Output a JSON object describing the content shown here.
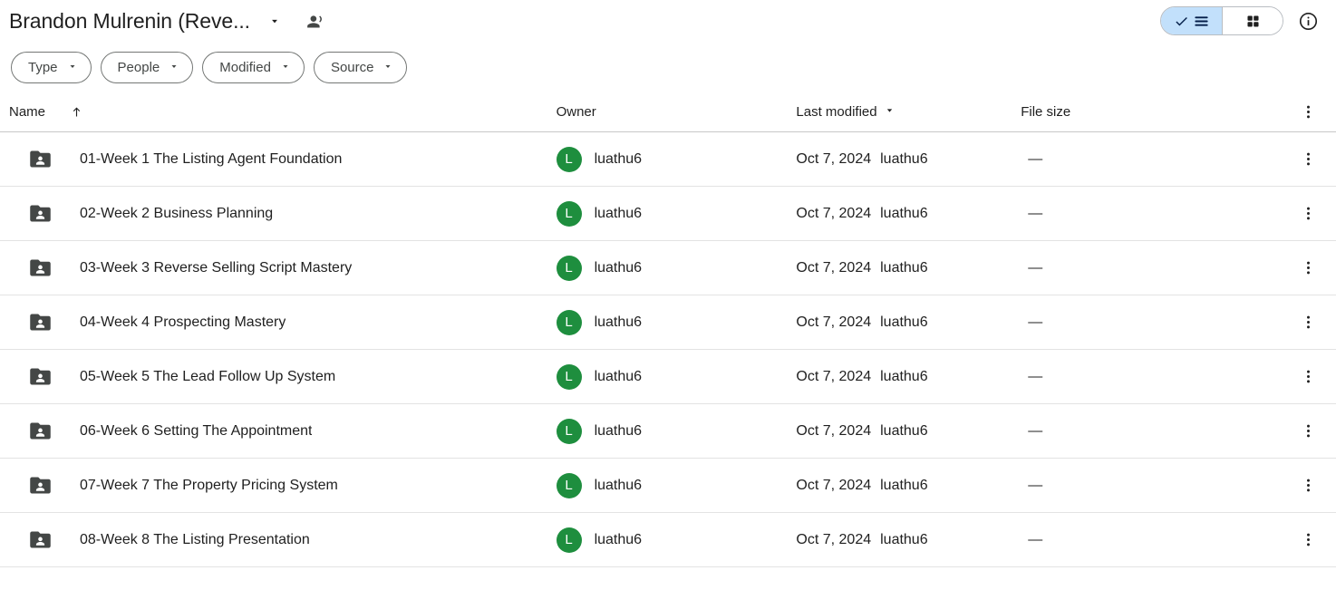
{
  "header": {
    "folder_title": "Brandon Mulrenin (Reve...",
    "caret_icon": "chevron-down-icon",
    "shared_icon": "people-shared-icon",
    "view_toggle": {
      "list_label": "list-view",
      "list_icon": "check-list-icon",
      "grid_label": "grid-view",
      "grid_icon": "grid-icon",
      "selected": "list"
    },
    "info_icon": "info-icon"
  },
  "filters": [
    {
      "label": "Type",
      "icon": "chevron-down-icon"
    },
    {
      "label": "People",
      "icon": "chevron-down-icon"
    },
    {
      "label": "Modified",
      "icon": "chevron-down-icon"
    },
    {
      "label": "Source",
      "icon": "chevron-down-icon"
    }
  ],
  "table": {
    "columns": {
      "name": "Name",
      "name_sort_icon": "arrow-up-icon",
      "owner": "Owner",
      "last_modified": "Last modified",
      "modified_sort_icon": "arrow-drop-down-icon",
      "file_size": "File size",
      "menu_icon": "more-options-icon"
    },
    "rows": [
      {
        "icon": "shared-folder-icon",
        "name": "01-Week 1 The Listing Agent Foundation",
        "avatar_letter": "L",
        "owner": "luathu6",
        "modified_date": "Oct 7, 2024",
        "modified_by": "luathu6",
        "size": "—"
      },
      {
        "icon": "shared-folder-icon",
        "name": "02-Week 2 Business Planning",
        "avatar_letter": "L",
        "owner": "luathu6",
        "modified_date": "Oct 7, 2024",
        "modified_by": "luathu6",
        "size": "—"
      },
      {
        "icon": "shared-folder-icon",
        "name": "03-Week 3 Reverse Selling Script Mastery",
        "avatar_letter": "L",
        "owner": "luathu6",
        "modified_date": "Oct 7, 2024",
        "modified_by": "luathu6",
        "size": "—"
      },
      {
        "icon": "shared-folder-icon",
        "name": "04-Week 4 Prospecting Mastery",
        "avatar_letter": "L",
        "owner": "luathu6",
        "modified_date": "Oct 7, 2024",
        "modified_by": "luathu6",
        "size": "—"
      },
      {
        "icon": "shared-folder-icon",
        "name": "05-Week 5 The Lead Follow Up System",
        "avatar_letter": "L",
        "owner": "luathu6",
        "modified_date": "Oct 7, 2024",
        "modified_by": "luathu6",
        "size": "—"
      },
      {
        "icon": "shared-folder-icon",
        "name": "06-Week 6 Setting The Appointment",
        "avatar_letter": "L",
        "owner": "luathu6",
        "modified_date": "Oct 7, 2024",
        "modified_by": "luathu6",
        "size": "—"
      },
      {
        "icon": "shared-folder-icon",
        "name": "07-Week 7 The Property Pricing System",
        "avatar_letter": "L",
        "owner": "luathu6",
        "modified_date": "Oct 7, 2024",
        "modified_by": "luathu6",
        "size": "—"
      },
      {
        "icon": "shared-folder-icon",
        "name": "08-Week 8 The Listing Presentation",
        "avatar_letter": "L",
        "owner": "luathu6",
        "modified_date": "Oct 7, 2024",
        "modified_by": "luathu6",
        "size": "—"
      }
    ]
  },
  "colors": {
    "avatar_green": "#1e8e3e",
    "toggle_selected_blue": "#c2e0fb",
    "folder_gray": "#444746",
    "divider": "#e3e3e3",
    "text": "#1f1f1f"
  }
}
